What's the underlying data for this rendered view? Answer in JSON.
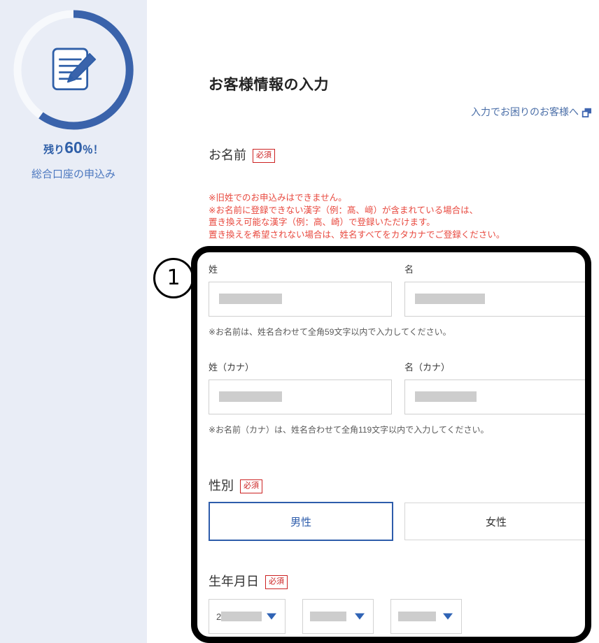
{
  "sidebar": {
    "progress_icon": "document-pencil-icon",
    "progress_percent": 60,
    "remaining_prefix": "残り",
    "remaining_value": "60",
    "remaining_unit": "％",
    "remaining_suffix": "！",
    "subtitle": "総合口座の申込み",
    "accent_color": "#3a63ab",
    "track_color": "#f6f8fb",
    "background": "#e9edf6"
  },
  "header": {
    "page_title": "お客様情報の入力",
    "help_link_label": "入力でお困りのお客様へ",
    "help_link_icon": "external-link-icon"
  },
  "required_badge": "必須",
  "name_section": {
    "label": "お名前",
    "required": true,
    "notes": [
      "※旧姓でのお申込みはできません。",
      "※お名前に登録できない漢字（例：髙、﨑）が含まれている場合は、",
      "置き換え可能な漢字（例：高、崎）で登録いただけます。",
      "置き換えを希望されない場合は、姓名すべてをカタカナでご登録ください。"
    ],
    "fields": [
      {
        "label": "姓",
        "value": "",
        "redacted": true,
        "redact_width": 90
      },
      {
        "label": "名",
        "value": "",
        "redacted": true,
        "redact_width": 100
      }
    ],
    "hint": "※お名前は、姓名合わせて全角59文字以内で入力してください。",
    "kana_fields": [
      {
        "label": "姓（カナ）",
        "value": "",
        "redacted": true,
        "redact_width": 90
      },
      {
        "label": "名（カナ）",
        "value": "",
        "redacted": true,
        "redact_width": 88
      }
    ],
    "kana_hint": "※お名前（カナ）は、姓名合わせて全角119文字以内で入力してください。"
  },
  "gender_section": {
    "label": "性別",
    "required": true,
    "options": [
      {
        "label": "男性",
        "selected": true
      },
      {
        "label": "女性",
        "selected": false
      }
    ],
    "selected_border_color": "#2d5cab"
  },
  "birth_section": {
    "label": "生年月日",
    "required": true,
    "selects": [
      {
        "name": "year-select",
        "visible_prefix": "2",
        "redacted": true,
        "redact_width": 58,
        "width": 108
      },
      {
        "name": "month-select",
        "visible_prefix": "",
        "redacted": true,
        "redact_width": 52,
        "width": 100
      },
      {
        "name": "day-select",
        "visible_prefix": "",
        "redacted": true,
        "redact_width": 54,
        "width": 100
      }
    ],
    "arrow_color": "#2f63b5"
  },
  "annotation": {
    "number_label": "①",
    "number_glyph": "1",
    "color": "#000000"
  }
}
